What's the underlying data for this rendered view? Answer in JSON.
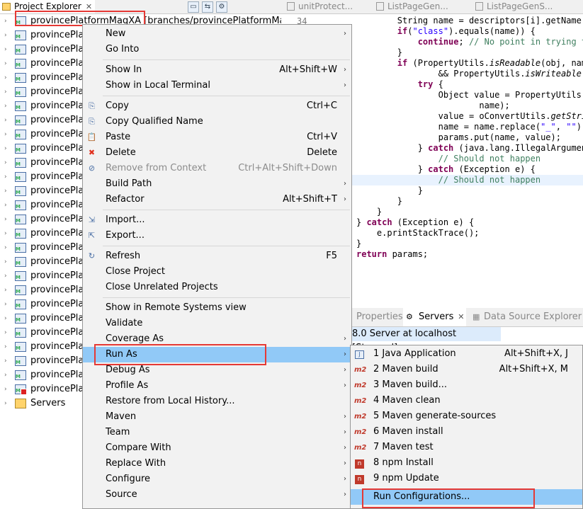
{
  "explorer": {
    "title": "Project Explorer",
    "first_item": "provincePlatformMagXA [branches/provincePlatformMag/pu",
    "items": [
      {
        "label": "provincePlat",
        "error": false
      },
      {
        "label": "provincePlat",
        "error": false
      },
      {
        "label": "provincePlat",
        "error": false
      },
      {
        "label": "provincePlat",
        "error": false
      },
      {
        "label": "provincePlat",
        "error": false
      },
      {
        "label": "provincePlat",
        "error": false
      },
      {
        "label": "provincePlat",
        "error": false
      },
      {
        "label": "provincePlat",
        "error": false
      },
      {
        "label": "provincePlat",
        "error": false
      },
      {
        "label": "provincePlat",
        "error": false
      },
      {
        "label": "provincePlat",
        "error": false
      },
      {
        "label": "provincePlat",
        "error": false
      },
      {
        "label": "provincePlat",
        "error": false
      },
      {
        "label": "provincePlat",
        "error": false
      },
      {
        "label": "provincePlat",
        "error": false
      },
      {
        "label": "provincePlat",
        "error": false
      },
      {
        "label": "provincePlat",
        "error": false
      },
      {
        "label": "provincePlat",
        "error": false
      },
      {
        "label": "provincePlat",
        "error": false
      },
      {
        "label": "provincePlat",
        "error": false
      },
      {
        "label": "provincePlat",
        "error": false
      },
      {
        "label": "provincePlat",
        "error": false
      },
      {
        "label": "provincePlat",
        "error": false
      },
      {
        "label": "provincePlat",
        "error": false
      },
      {
        "label": "provincePlat",
        "error": false
      },
      {
        "label": "provincePlat",
        "error": true
      },
      {
        "label": "Servers",
        "error": false,
        "folder": true
      }
    ]
  },
  "editor": {
    "tabs": [
      "unitProtect...",
      "ListPageGen...",
      "ListPageGenS..."
    ],
    "line_number": "34",
    "code": [
      {
        "segs": [
          [
            "",
            "        String name = descriptors[i].getName()"
          ]
        ]
      },
      {
        "segs": [
          [
            "kw",
            "        if"
          ],
          [
            "",
            "("
          ],
          [
            "str",
            "\"class\""
          ],
          [
            "",
            ").equals(name)) {"
          ]
        ]
      },
      {
        "segs": [
          [
            "kw",
            "            continue"
          ],
          [
            "",
            "; "
          ],
          [
            "cm",
            "// No point in trying to"
          ]
        ]
      },
      {
        "segs": [
          [
            "",
            "        }"
          ]
        ]
      },
      {
        "segs": [
          [
            "kw",
            "        if"
          ],
          [
            "",
            " (PropertyUtils."
          ],
          [
            "it",
            "isReadable"
          ],
          [
            "",
            "(obj, name"
          ]
        ]
      },
      {
        "segs": [
          [
            "",
            "                && PropertyUtils."
          ],
          [
            "it",
            "isWriteable"
          ],
          [
            "",
            "(o"
          ]
        ]
      },
      {
        "segs": [
          [
            "kw",
            "            try"
          ],
          [
            "",
            " {"
          ]
        ]
      },
      {
        "segs": [
          [
            "",
            "                Object value = PropertyUtils.g"
          ]
        ]
      },
      {
        "segs": [
          [
            "",
            "                        name);"
          ]
        ]
      },
      {
        "segs": [
          [
            "",
            "                value = oConvertUtils."
          ],
          [
            "it",
            "getStrin"
          ]
        ]
      },
      {
        "segs": [
          [
            "",
            "                name = name.replace("
          ],
          [
            "str",
            "\"_\""
          ],
          [
            "",
            ", "
          ],
          [
            "str",
            "\"\""
          ],
          [
            "",
            ").t"
          ]
        ]
      },
      {
        "segs": [
          [
            "",
            "                params.put(name, value);"
          ]
        ]
      },
      {
        "segs": [
          [
            "",
            "            } "
          ],
          [
            "kw",
            "catch"
          ],
          [
            "",
            " (java.lang.IllegalArgument"
          ]
        ]
      },
      {
        "segs": [
          [
            "cm",
            "                // Should not happen"
          ]
        ]
      },
      {
        "segs": [
          [
            "",
            "            } "
          ],
          [
            "kw",
            "catch"
          ],
          [
            "",
            " (Exception e) {"
          ]
        ]
      },
      {
        "segs": [
          [
            "cm",
            "                // Should not happen"
          ]
        ],
        "hl": true
      },
      {
        "segs": [
          [
            "",
            "            }"
          ]
        ]
      },
      {
        "segs": [
          [
            "",
            "        }"
          ]
        ]
      },
      {
        "segs": [
          [
            "",
            "    }"
          ]
        ]
      },
      {
        "segs": [
          [
            "",
            "} "
          ],
          [
            "kw",
            "catch"
          ],
          [
            "",
            " (Exception e) {"
          ]
        ]
      },
      {
        "segs": [
          [
            "",
            "    e.printStackTrace();"
          ]
        ]
      },
      {
        "segs": [
          [
            "",
            "}"
          ]
        ]
      },
      {
        "segs": [
          [
            "kw",
            "return"
          ],
          [
            "",
            " params;"
          ]
        ]
      }
    ]
  },
  "servers_view": {
    "tabs": [
      "Properties",
      "Servers",
      "Data Source Explorer"
    ],
    "server_row": "8.0 Server at localhost  [Stopped]"
  },
  "context_menu": {
    "items": [
      {
        "label": "New",
        "accel": "",
        "submenu": true
      },
      {
        "label": "Go Into",
        "accel": ""
      },
      {
        "sep": true
      },
      {
        "label": "Show In",
        "accel": "Alt+Shift+W",
        "submenu": true
      },
      {
        "label": "Show in Local Terminal",
        "accel": "",
        "submenu": true
      },
      {
        "sep": true
      },
      {
        "label": "Copy",
        "accel": "Ctrl+C",
        "icon": "copy-icon",
        "glyph": "⎘"
      },
      {
        "label": "Copy Qualified Name",
        "accel": "",
        "icon": "copy-qualified-icon",
        "glyph": "⎘"
      },
      {
        "label": "Paste",
        "accel": "Ctrl+V",
        "icon": "paste-icon",
        "glyph": "📋"
      },
      {
        "label": "Delete",
        "accel": "Delete",
        "icon": "delete-icon",
        "glyph": "✖",
        "icon_color": "#e0301e"
      },
      {
        "label": "Remove from Context",
        "accel": "Ctrl+Alt+Shift+Down",
        "disabled": true,
        "icon": "remove-context-icon",
        "glyph": "⊘"
      },
      {
        "label": "Build Path",
        "accel": "",
        "submenu": true
      },
      {
        "label": "Refactor",
        "accel": "Alt+Shift+T",
        "submenu": true
      },
      {
        "sep": true
      },
      {
        "label": "Import...",
        "accel": "",
        "icon": "import-icon",
        "glyph": "⇲"
      },
      {
        "label": "Export...",
        "accel": "",
        "icon": "export-icon",
        "glyph": "⇱"
      },
      {
        "sep": true
      },
      {
        "label": "Refresh",
        "accel": "F5",
        "icon": "refresh-icon",
        "glyph": "↻"
      },
      {
        "label": "Close Project",
        "accel": ""
      },
      {
        "label": "Close Unrelated Projects",
        "accel": ""
      },
      {
        "sep": true
      },
      {
        "label": "Show in Remote Systems view",
        "accel": ""
      },
      {
        "label": "Validate",
        "accel": ""
      },
      {
        "label": "Coverage As",
        "accel": "",
        "submenu": true
      },
      {
        "label": "Run As",
        "accel": "",
        "submenu": true,
        "selected": true
      },
      {
        "label": "Debug As",
        "accel": "",
        "submenu": true
      },
      {
        "label": "Profile As",
        "accel": "",
        "submenu": true
      },
      {
        "label": "Restore from Local History...",
        "accel": ""
      },
      {
        "label": "Maven",
        "accel": "",
        "submenu": true
      },
      {
        "label": "Team",
        "accel": "",
        "submenu": true
      },
      {
        "label": "Compare With",
        "accel": "",
        "submenu": true
      },
      {
        "label": "Replace With",
        "accel": "",
        "submenu": true
      },
      {
        "label": "Configure",
        "accel": "",
        "submenu": true
      },
      {
        "label": "Source",
        "accel": "",
        "submenu": true
      }
    ]
  },
  "run_as_menu": {
    "items": [
      {
        "label": "1 Java Application",
        "accel": "Alt+Shift+X, J",
        "icon": "java-app"
      },
      {
        "label": "2 Maven build",
        "accel": "Alt+Shift+X, M",
        "icon": "m2"
      },
      {
        "label": "3 Maven build...",
        "accel": "",
        "icon": "m2"
      },
      {
        "label": "4 Maven clean",
        "accel": "",
        "icon": "m2"
      },
      {
        "label": "5 Maven generate-sources",
        "accel": "",
        "icon": "m2"
      },
      {
        "label": "6 Maven install",
        "accel": "",
        "icon": "m2"
      },
      {
        "label": "7 Maven test",
        "accel": "",
        "icon": "m2"
      },
      {
        "label": "8 npm Install",
        "accel": "",
        "icon": "npm"
      },
      {
        "label": "9 npm Update",
        "accel": "",
        "icon": "npm"
      },
      {
        "sep": true
      },
      {
        "label": "Run Configurations...",
        "accel": "",
        "selected": true
      }
    ],
    "m2_text": "m2",
    "npm_text": "n",
    "java_text": "J"
  },
  "colors": {
    "highlight_box": "#e53935",
    "menu_selected": "#91c9f7",
    "menu_bg": "#f2f2f2"
  }
}
